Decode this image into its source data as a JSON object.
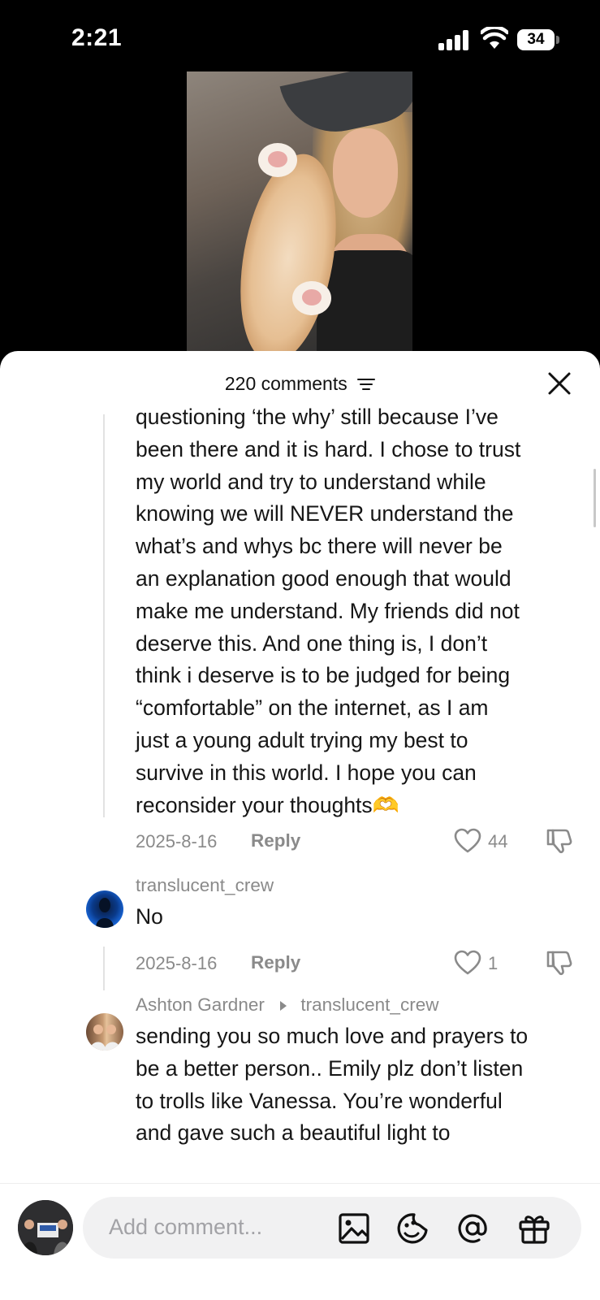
{
  "status_bar": {
    "time": "2:21",
    "battery": "34",
    "icons": [
      "cellular-signal-icon",
      "wifi-icon",
      "battery-icon"
    ]
  },
  "comments_sheet": {
    "header": {
      "count_label": "220 comments",
      "filter_icon": "sort-lines-icon",
      "close_icon": "close-x-icon"
    },
    "comments": [
      {
        "lines": [
          "questioning ‘the why’ still because I’ve",
          "been there and it is hard. I chose to trust",
          "my world and try to understand while",
          "knowing we will NEVER understand the",
          "what’s and whys bc there will never be",
          "an explanation good enough that would",
          "make me understand. My friends did not",
          "deserve this. And one thing is, I don’t",
          "think i deserve is to be judged for being",
          "“comfortable” on the internet, as I am",
          "just a young adult trying my best to",
          "survive in this world. I hope you can",
          "reconsider your thoughts🫶"
        ],
        "date": "2025-8-16",
        "reply_label": "Reply",
        "likes": "44"
      },
      {
        "username": "translucent_crew",
        "text": "No",
        "date": "2025-8-16",
        "reply_label": "Reply",
        "likes": "1"
      },
      {
        "username": "Ashton Gardner",
        "reply_to": "translucent_crew",
        "lines": [
          "sending you so much love and prayers to",
          "be a better person.. Emily plz don’t listen",
          "to trolls like Vanessa. You’re wonderful",
          "and gave such a beautiful light to"
        ]
      }
    ]
  },
  "input_bar": {
    "placeholder": "Add comment...",
    "icons": [
      "image-icon",
      "emoji-sticker-icon",
      "mention-at-icon",
      "gift-icon"
    ]
  }
}
